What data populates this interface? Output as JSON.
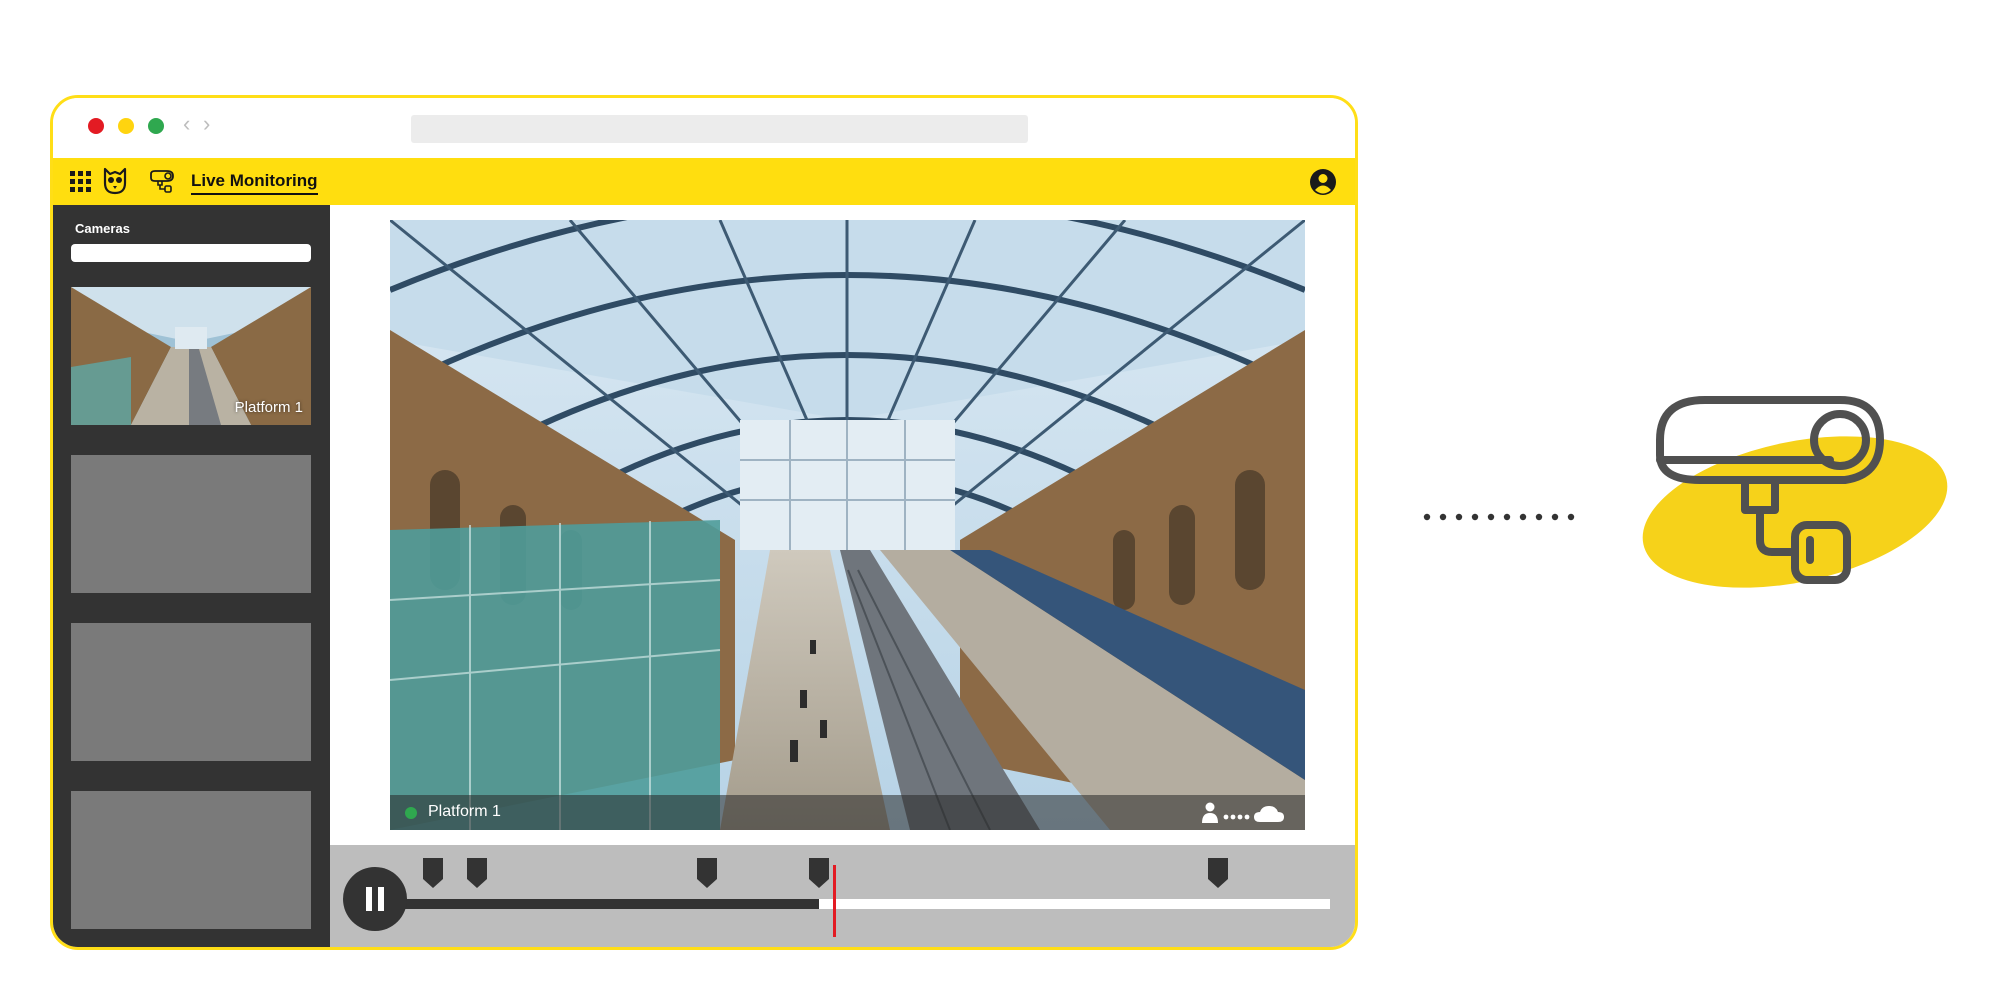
{
  "colors": {
    "brand_yellow": "#ffde0f",
    "sidebar_bg": "#333333",
    "timeline_bg": "#bdbdbd",
    "playhead": "#e31b23",
    "live_indicator": "#2fa84f",
    "icon_stroke": "#505050"
  },
  "app_bar": {
    "title": "Live Monitoring",
    "icons": [
      "apps-grid-icon",
      "owl-logo-icon",
      "security-camera-icon",
      "user-account-icon"
    ]
  },
  "sidebar": {
    "heading": "Cameras",
    "cameras": [
      {
        "label": "Platform 1",
        "active": true
      },
      {
        "label": "",
        "active": false
      },
      {
        "label": "",
        "active": false
      },
      {
        "label": "",
        "active": false
      }
    ]
  },
  "player": {
    "camera_label": "Platform 1",
    "live": true,
    "status_icons": [
      "person-icon",
      "signal-dots-icon",
      "cloud-icon"
    ]
  },
  "timeline": {
    "playback_state": "playing",
    "progress": 0.45,
    "playhead": 0.467,
    "markers": [
      0.035,
      0.083,
      0.33,
      0.45,
      0.88
    ]
  }
}
